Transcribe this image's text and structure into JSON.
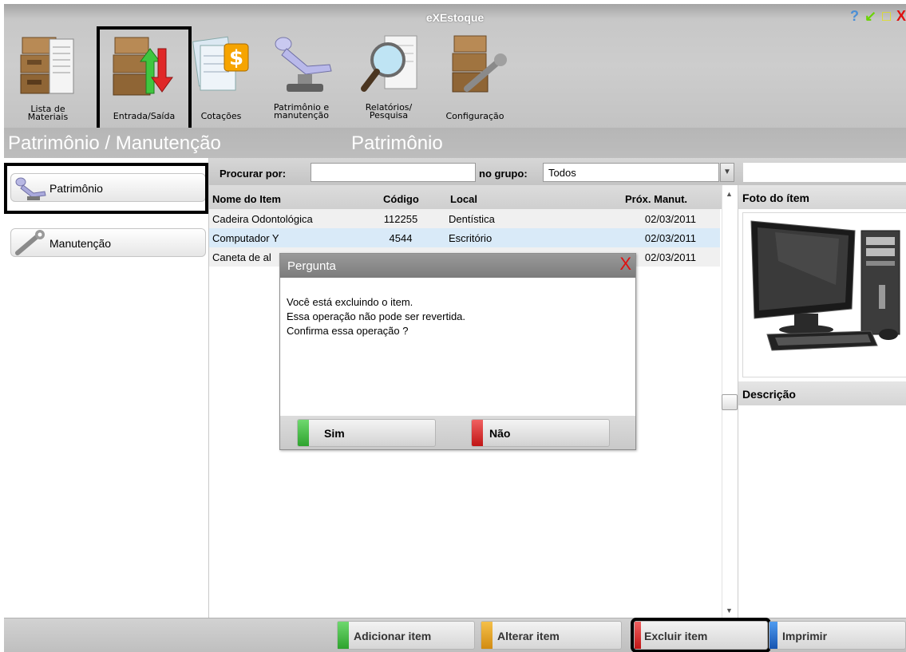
{
  "window": {
    "title": "eXEstoque",
    "controls": {
      "help": "?",
      "minimize": "↙",
      "maximize": "□",
      "close": "X"
    }
  },
  "toolbar": {
    "tools": [
      {
        "label": "Lista de\nMateriais",
        "icon": "boxes-list-icon"
      },
      {
        "label": "Entrada/Saída",
        "icon": "entry-exit-arrows-icon"
      },
      {
        "label": "Cotações",
        "icon": "quote-dollar-icon"
      },
      {
        "label": "Patrimônio e\nmanutenção",
        "icon": "dental-chair-icon"
      },
      {
        "label": "Relatórios/\nPesquisa",
        "icon": "report-magnifier-icon"
      },
      {
        "label": "Configuração",
        "icon": "box-wrench-icon"
      }
    ]
  },
  "section": {
    "left": "Patrimônio / Manutenção",
    "right": "Patrimônio"
  },
  "left_nav": {
    "items": [
      {
        "label": "Patrimônio",
        "icon": "dental-chair-icon"
      },
      {
        "label": "Manutenção",
        "icon": "wrench-icon"
      }
    ]
  },
  "search": {
    "search_label": "Procurar por:",
    "search_value": "",
    "group_label": "no grupo:",
    "group_value": "Todos"
  },
  "table": {
    "headers": {
      "name": "Nome do Item",
      "code": "Código",
      "location": "Local",
      "next_maintenance": "Próx. Manut."
    },
    "rows": [
      {
        "name": "Cadeira Odontológica",
        "code": "112255",
        "location": "Dentística",
        "next_maintenance": "02/03/2011"
      },
      {
        "name": "Computador Y",
        "code": "4544",
        "location": "Escritório",
        "next_maintenance": "02/03/2011"
      },
      {
        "name": "Caneta de al",
        "code": "",
        "location": "",
        "next_maintenance": "02/03/2011"
      }
    ]
  },
  "photo_panel": {
    "photo_title": "Foto do ítem",
    "description_title": "Descrição"
  },
  "dialog": {
    "title": "Pergunta",
    "close": "X",
    "lines": [
      "Você está excluindo o item.",
      "Essa operação não pode ser revertida.",
      "Confirma essa operação ?"
    ],
    "yes_label": "Sim",
    "no_label": "Não"
  },
  "bottom_bar": {
    "add_label": "Adicionar item",
    "edit_label": "Alterar item",
    "delete_label": "Excluir item",
    "print_label": "Imprimir"
  },
  "colors": {
    "green": "#3bb33b",
    "orange": "#e6a22a",
    "red": "#e02020",
    "blue": "#1f6fd6",
    "selected_row": "#d9eaf8"
  }
}
